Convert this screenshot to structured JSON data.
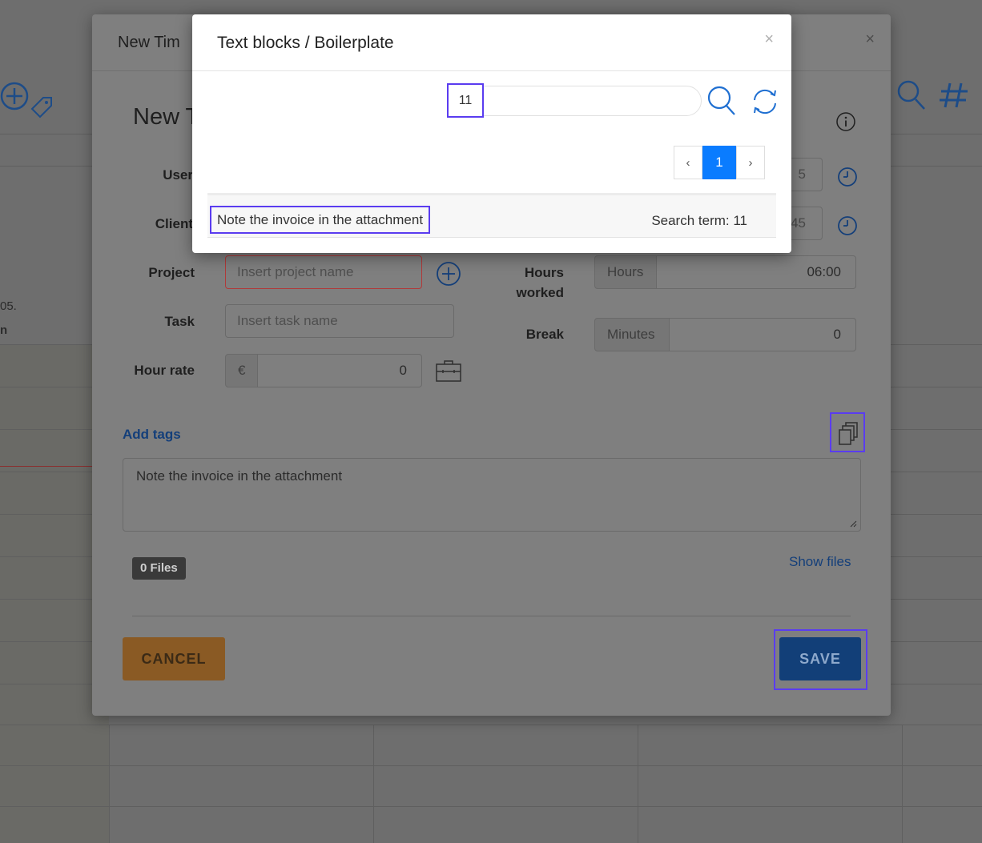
{
  "background": {
    "left_date_fragment": "05.",
    "left_bold_fragment": "n",
    "icons": [
      "add-tag-icon",
      "search-icon",
      "hash-icon"
    ]
  },
  "modal": {
    "title": "New Tim",
    "heading": "New T",
    "close_symbol": "×",
    "fields": {
      "user_label": "User",
      "client_label": "Client",
      "project_label": "Project",
      "project_placeholder": "Insert project name",
      "task_label": "Task",
      "task_placeholder": "Insert task name",
      "hour_rate_label": "Hour rate",
      "currency_symbol": "€",
      "hour_rate_value": "0",
      "hours_worked_label_line1": "Hours",
      "hours_worked_label_line2": "worked",
      "hours_addon": "Hours",
      "hours_value": "06:00",
      "break_label": "Break",
      "minutes_addon": "Minutes",
      "break_value": "0",
      "user_time_fragment": "5",
      "client_time_fragment": "45"
    },
    "add_tags_label": "Add tags",
    "note_text": "Note the invoice in the attachment",
    "files_badge": "0 Files",
    "show_files_label": "Show files",
    "cancel_label": "CANCEL",
    "save_label": "SAVE",
    "colors": {
      "accent_blue": "#143f7a",
      "cancel_orange": "#8a5a24",
      "save_blue": "#123f78",
      "highlight": "#5a3cf0"
    }
  },
  "dialog": {
    "title": "Text blocks / Boilerplate",
    "close_symbol": "×",
    "search_value": "11",
    "pagination": {
      "prev": "‹",
      "current": "1",
      "next": "›"
    },
    "results": [
      {
        "text": "Note the invoice in the attachment",
        "term_label": "Search term: 11"
      }
    ],
    "colors": {
      "active_page": "#0a7cff"
    }
  }
}
